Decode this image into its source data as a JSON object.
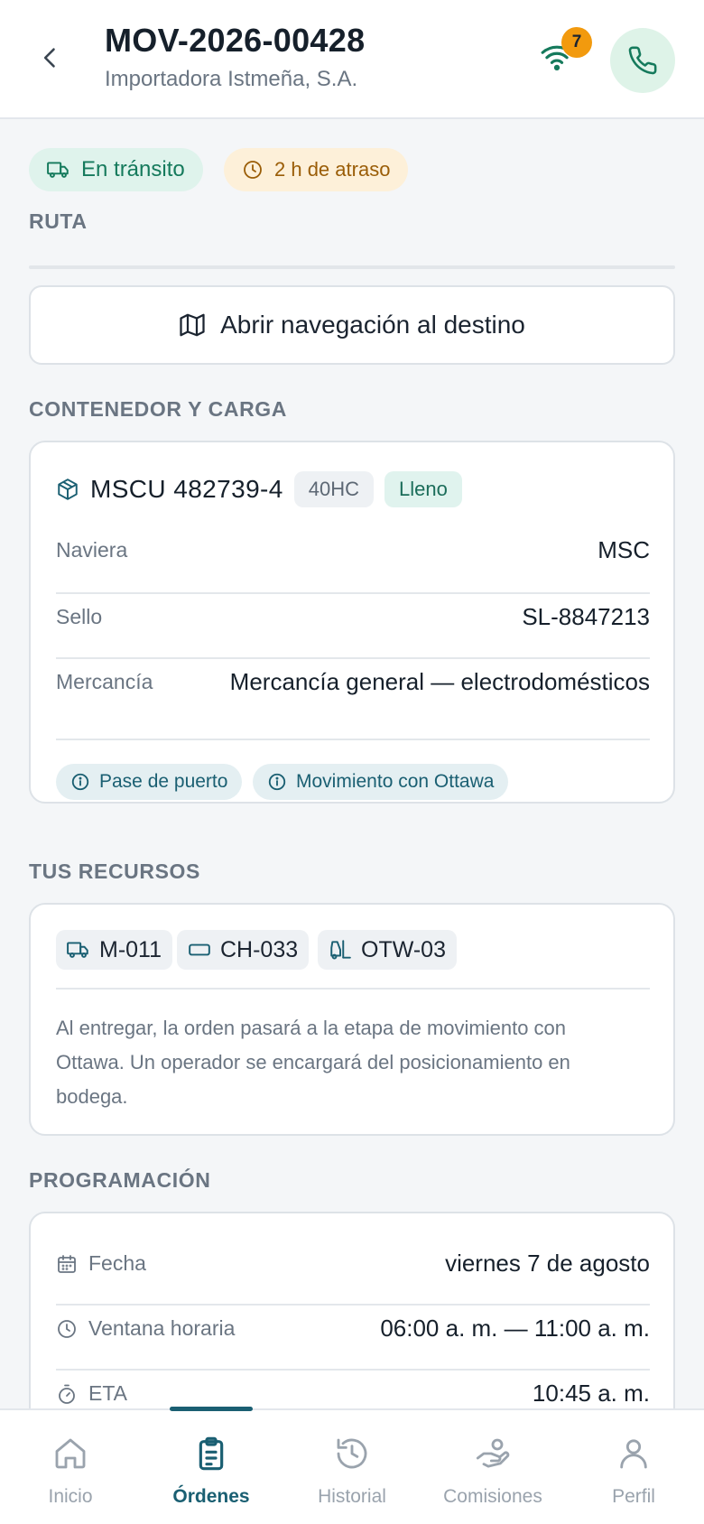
{
  "header": {
    "title": "MOV-2026-00428",
    "subtitle": "Importadora Istmeña, S.A.",
    "signal_count": "7",
    "colors": {
      "accent": "#1a5f72",
      "call": "#157a5c",
      "warning": "#f29a0e"
    }
  },
  "status": {
    "transit_label": "En tránsito",
    "delay_label": "2 h de atraso"
  },
  "route": {
    "section_label": "RUTA",
    "navigate_label": "Abrir navegación al destino"
  },
  "container": {
    "section_label": "CONTENEDOR Y CARGA",
    "id": "MSCU 482739-4",
    "size_tag": "40HC",
    "state_tag": "Lleno",
    "rows": [
      {
        "label": "Naviera",
        "value": "MSC"
      },
      {
        "label": "Sello",
        "value": "SL-8847213"
      },
      {
        "label": "Mercancía",
        "value": "Mercancía general — electrodomésticos"
      }
    ],
    "chips": [
      "Pase de puerto",
      "Movimiento con Ottawa"
    ]
  },
  "resources": {
    "section_label": "TUS RECURSOS",
    "tags": [
      {
        "icon": "truck-icon",
        "label": "M-011"
      },
      {
        "icon": "chassis-icon",
        "label": "CH-033"
      },
      {
        "icon": "forklift-icon",
        "label": "OTW-03"
      }
    ],
    "note": "Al entregar, la orden pasará a la etapa de movimiento con Ottawa. Un operador se encargará del posicionamiento en bodega."
  },
  "schedule": {
    "section_label": "PROGRAMACIÓN",
    "rows": [
      {
        "icon": "calendar-icon",
        "label": "Fecha",
        "value": "viernes 7 de agosto"
      },
      {
        "icon": "clock-icon",
        "label": "Ventana horaria",
        "value": "06:00 a. m. — 11:00 a. m."
      },
      {
        "icon": "timer-icon",
        "label": "ETA",
        "value": "10:45 a. m."
      }
    ]
  },
  "bottom_nav": {
    "items": [
      {
        "icon": "home-icon",
        "label": "Inicio"
      },
      {
        "icon": "clipboard-icon",
        "label": "Órdenes"
      },
      {
        "icon": "history-icon",
        "label": "Historial"
      },
      {
        "icon": "commission-icon",
        "label": "Comisiones"
      },
      {
        "icon": "user-icon",
        "label": "Perfil"
      }
    ],
    "active": "Órdenes"
  }
}
